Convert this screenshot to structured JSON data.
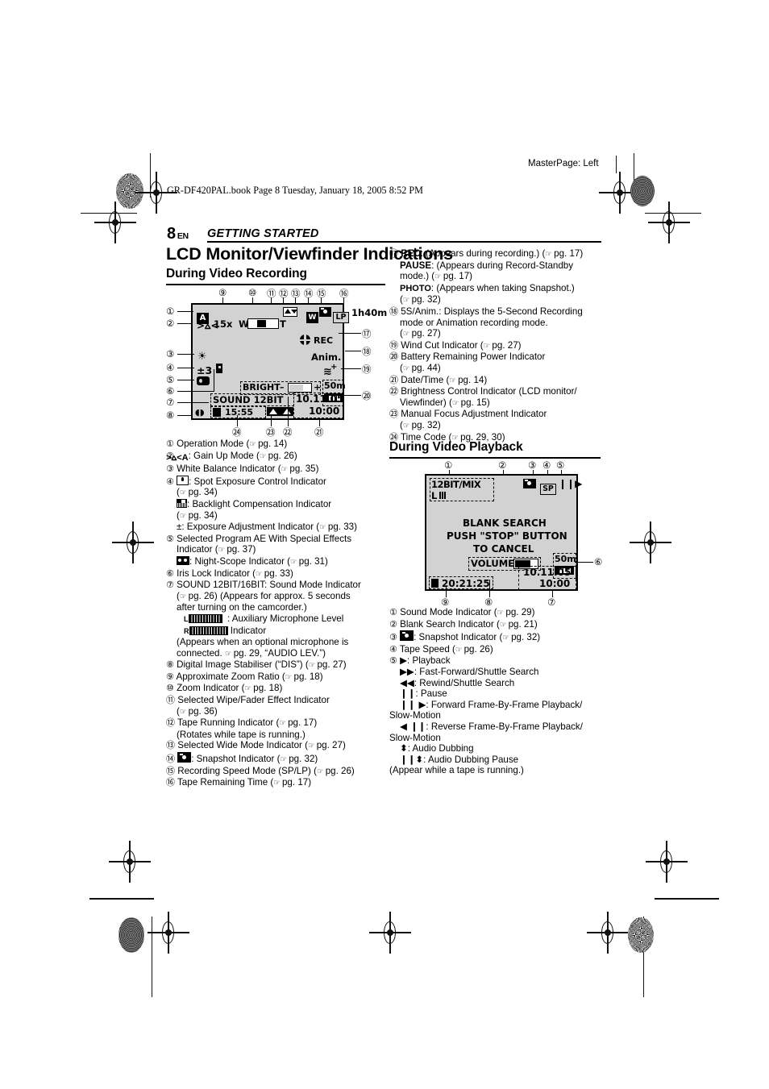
{
  "printmarks": {
    "masterpage": "MasterPage: Left",
    "bookline": "GR-DF420PAL.book  Page 8  Tuesday, January 18, 2005  8:52 PM"
  },
  "header": {
    "page_number": "8",
    "lang": "EN",
    "section": "GETTING STARTED"
  },
  "title": "LCD Monitor/Viewfinder Indications",
  "sections": {
    "recording": {
      "heading": "During Video Recording"
    },
    "playback": {
      "heading": "During Video Playback"
    }
  },
  "recording_display": {
    "callouts_top": [
      "9",
      "10",
      "11",
      "12",
      "13",
      "14",
      "15",
      "16"
    ],
    "callouts_left": [
      "1",
      "2",
      "3",
      "4",
      "5",
      "6",
      "7",
      "8"
    ],
    "callouts_right": [
      "17",
      "18",
      "19",
      "20"
    ],
    "callouts_bottom": [
      "24",
      "23",
      "22",
      "21"
    ],
    "op_mode": "A",
    "zoom_ratio": "15x",
    "zoom_w": "W",
    "zoom_t": "T",
    "wide_mode": "W",
    "speed_mode": "LP",
    "tape_remaining": "1h40m",
    "rec_status": "REC",
    "anim": "Anim.",
    "exposure": "±3",
    "bright_label": "BRIGHT",
    "bright_minus": "–",
    "bright_plus": "+",
    "sound_mode": "SOUND  12BIT",
    "tape_length": "50m",
    "date": "10.11.05",
    "time": "10:00",
    "time_code": "15:55"
  },
  "playback_display": {
    "callouts_top": [
      "1",
      "2",
      "3",
      "4",
      "5"
    ],
    "callouts_bottom": [
      "9",
      "8",
      "7"
    ],
    "callout_right": "6",
    "sound_mode": "12BIT/MIX",
    "sound_channel": "L",
    "speed_mode": "SP",
    "transport": "❙❙▶",
    "message_line1": "BLANK  SEARCH",
    "message_line2": "PUSH \"STOP\" BUTTON",
    "message_line3": "TO  CANCEL",
    "volume_label": "VOLUME",
    "tape_length": "50m",
    "date": "10.11.05",
    "time": "10:00",
    "time_code": "20:21:25"
  },
  "recording_list": [
    {
      "num": "1",
      "text": "Operation Mode (",
      "ref": "pg. 14",
      "tail": ")"
    },
    {
      "num": "2",
      "icon": "gain-up",
      "text": ": Gain Up Mode (",
      "ref": "pg. 26",
      "tail": ")"
    },
    {
      "num": "3",
      "text": "White Balance Indicator (",
      "ref": "pg. 35",
      "tail": ")"
    },
    {
      "num": "4",
      "icon": "spot-exposure",
      "text": ": Spot Exposure Control Indicator",
      "cont": [
        "(",
        "pg. 34",
        ")"
      ]
    },
    {
      "num": "",
      "icon": "backlight",
      "text": ": Backlight Compensation Indicator",
      "cont": [
        "(",
        "pg. 34",
        ")"
      ]
    },
    {
      "num": "",
      "text": "±: Exposure Adjustment Indicator (",
      "ref": "pg. 33",
      "tail": ")"
    },
    {
      "num": "5",
      "text": "Selected Program AE With Special Effects",
      "cont2": "Indicator (",
      "ref": "pg. 37",
      "tail": ")"
    },
    {
      "num": "",
      "icon": "night-scope",
      "text": ": Night-Scope Indicator (",
      "ref": "pg. 31",
      "tail": ")"
    },
    {
      "num": "6",
      "text": "Iris Lock Indicator (",
      "ref": "pg. 33",
      "tail": ")"
    },
    {
      "num": "7",
      "text": "SOUND 12BIT/16BIT: Sound Mode Indicator",
      "cont2": "(",
      "ref": "pg. 26",
      "tail": ") (Appears for approx. 5 seconds",
      "cont3": "after turning on the camcorder.)"
    },
    {
      "num": "",
      "icon": "mic-level",
      "text": ": Auxiliary Microphone Level",
      "cont2b": "Indicator"
    },
    {
      "num": "",
      "text": "(Appears when an optional microphone is",
      "cont2": "connected. ",
      "ref": "pg. 29",
      "tail": ", “AUDIO LEV.”)"
    },
    {
      "num": "8",
      "text": "Digital Image Stabiliser (“DIS”) (",
      "ref": "pg. 27",
      "tail": ")"
    },
    {
      "num": "9",
      "text": "Approximate Zoom Ratio (",
      "ref": "pg. 18",
      "tail": ")"
    },
    {
      "num": "10",
      "text": "Zoom Indicator (",
      "ref": "pg. 18",
      "tail": ")"
    },
    {
      "num": "11",
      "text": "Selected Wipe/Fader Effect Indicator",
      "cont": [
        "(",
        "pg. 36",
        ")"
      ]
    },
    {
      "num": "12",
      "text": "Tape Running Indicator (",
      "ref": "pg. 17",
      "tail": ")",
      "cont3": "(Rotates while tape is running.)"
    },
    {
      "num": "13",
      "text": "Selected Wide Mode Indicator (",
      "ref": "pg. 27",
      "tail": ")"
    },
    {
      "num": "14",
      "icon": "snapshot",
      "text": ": Snapshot Indicator (",
      "ref": "pg. 32",
      "tail": ")"
    },
    {
      "num": "15",
      "text": "Recording Speed Mode (SP/LP) (",
      "ref": "pg. 26",
      "tail": ")"
    },
    {
      "num": "16",
      "text": "Tape Remaining Time (",
      "ref": "pg. 17",
      "tail": ")"
    }
  ],
  "recording_list_right": [
    {
      "num": "17",
      "bold": "REC",
      "text": ": (Appears during recording.) (",
      "ref": "pg. 17",
      "tail": ")"
    },
    {
      "num": "",
      "bold": "PAUSE",
      "text": ": (Appears during Record-Standby",
      "cont2": "mode.) (",
      "ref": "pg. 17",
      "tail": ")"
    },
    {
      "num": "",
      "bold": "PHOTO",
      "text": ": (Appears when taking Snapshot.)",
      "cont": [
        "(",
        "pg. 32",
        ")"
      ]
    },
    {
      "num": "18",
      "text": "5S/Anim.: Displays the 5-Second Recording",
      "cont2": "mode or Animation recording mode.",
      "cont": [
        "(",
        "pg. 27",
        ")"
      ]
    },
    {
      "num": "19",
      "text": "Wind Cut Indicator (",
      "ref": "pg. 27",
      "tail": ")"
    },
    {
      "num": "20",
      "text": "Battery Remaining Power Indicator",
      "cont": [
        "(",
        "pg. 44",
        ")"
      ]
    },
    {
      "num": "21",
      "text": "Date/Time (",
      "ref": "pg. 14",
      "tail": ")"
    },
    {
      "num": "22",
      "text": "Brightness Control Indicator (LCD monitor/",
      "cont2": "Viewfinder) (",
      "ref": "pg. 15",
      "tail": ")"
    },
    {
      "num": "23",
      "text": "Manual Focus Adjustment Indicator",
      "cont": [
        "(",
        "pg. 32",
        ")"
      ]
    },
    {
      "num": "24",
      "text": "Time Code (",
      "ref": "pg. 29, 30",
      "tail": ")"
    }
  ],
  "playback_list": [
    {
      "num": "1",
      "text": "Sound Mode Indicator (",
      "ref": "pg. 29",
      "tail": ")"
    },
    {
      "num": "2",
      "text": "Blank Search Indicator (",
      "ref": "pg. 21",
      "tail": ")"
    },
    {
      "num": "3",
      "icon": "snapshot",
      "text": ": Snapshot Indicator (",
      "ref": "pg. 32",
      "tail": ")"
    },
    {
      "num": "4",
      "text": "Tape Speed (",
      "ref": "pg. 26",
      "tail": ")"
    },
    {
      "num": "5",
      "glyph": "▶",
      "text": ": Playback"
    },
    {
      "num": "",
      "glyph": "▶▶",
      "text": ": Fast-Forward/Shuttle Search"
    },
    {
      "num": "",
      "glyph": "◀◀",
      "text": ": Rewind/Shuttle Search"
    },
    {
      "num": "",
      "glyph": "❙❙",
      "text": ": Pause"
    },
    {
      "num": "",
      "glyph": "❙❙ ▶",
      "text": ": Forward Frame-By-Frame Playback/",
      "cont3": "Slow-Motion"
    },
    {
      "num": "",
      "glyph": "◀ ❙❙",
      "text": ": Reverse Frame-By-Frame Playback/",
      "cont3": "Slow-Motion"
    },
    {
      "num": "",
      "glyph": "⬍",
      "text": ": Audio Dubbing"
    },
    {
      "num": "",
      "glyph": "❙❙⬍",
      "text": ": Audio Dubbing Pause"
    },
    {
      "num": "",
      "text": "(Appear while a tape is running.)"
    }
  ]
}
